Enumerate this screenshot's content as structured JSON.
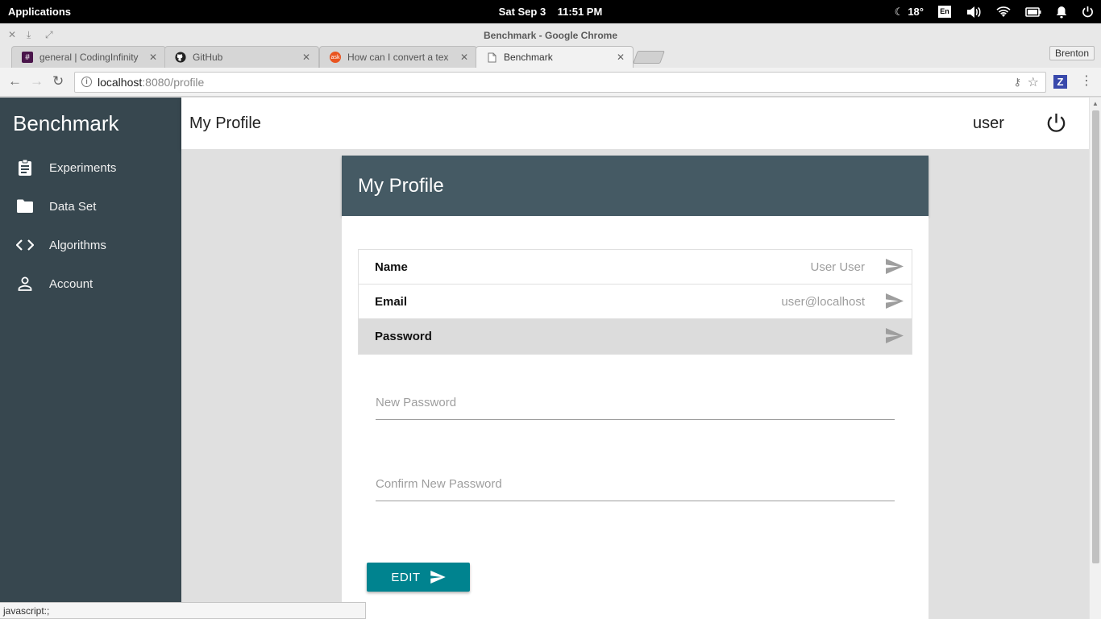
{
  "system_panel": {
    "applications": "Applications",
    "date": "Sat Sep  3",
    "time": "11:51 PM",
    "temperature": "18°",
    "keyboard_layout": "En"
  },
  "window": {
    "title": "Benchmark - Google Chrome"
  },
  "tabs": [
    {
      "label": "general | CodingInfinity",
      "favicon": "slack-hash-icon"
    },
    {
      "label": "GitHub",
      "favicon": "github-icon"
    },
    {
      "label": "How can I convert a tex",
      "favicon": "askubuntu-icon"
    },
    {
      "label": "Benchmark",
      "favicon": "page-icon"
    }
  ],
  "profile_name": "Brenton",
  "address_bar": {
    "host": "localhost",
    "path": ":8080/profile"
  },
  "sidebar": {
    "brand": "Benchmark",
    "items": [
      {
        "label": "Experiments",
        "icon": "clipboard-icon"
      },
      {
        "label": "Data Set",
        "icon": "folder-icon"
      },
      {
        "label": "Algorithms",
        "icon": "code-icon"
      },
      {
        "label": "Account",
        "icon": "person-icon"
      }
    ]
  },
  "appbar": {
    "title": "My Profile",
    "username": "user"
  },
  "card": {
    "title": "My Profile",
    "rows": [
      {
        "label": "Name",
        "value": "User User"
      },
      {
        "label": "Email",
        "value": "user@localhost"
      },
      {
        "label": "Password",
        "value": ""
      }
    ],
    "new_password_placeholder": "New Password",
    "confirm_password_placeholder": "Confirm New Password",
    "edit_label": "EDIT"
  },
  "status_bar": "javascript:;",
  "colors": {
    "sidebar_bg": "#37474f",
    "card_header_bg": "#455a64",
    "primary_button": "#00838f",
    "selected_row": "#dcdcdc"
  }
}
